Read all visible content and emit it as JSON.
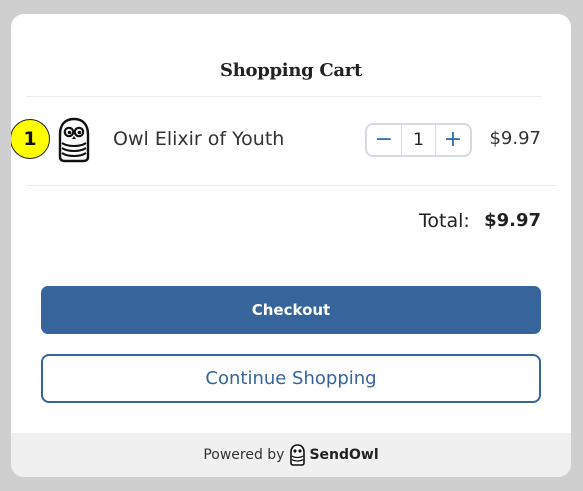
{
  "cart": {
    "title": "Shopping Cart",
    "item": {
      "badge": "1",
      "name": "Owl Elixir of Youth",
      "quantity": "1",
      "decrement_symbol": "−",
      "increment_symbol": "+",
      "price": "$9.97",
      "icon": "owl-logo-icon"
    },
    "total_label": "Total:",
    "total_value": "$9.97",
    "checkout_label": "Checkout",
    "continue_label": "Continue Shopping"
  },
  "footer": {
    "powered_by": "Powered by",
    "brand": "SendOwl",
    "brand_icon": "sendowl-logo-icon"
  },
  "colors": {
    "page_bg": "#cfcfcf",
    "accent": "#37649b",
    "badge": "#ffff00",
    "footer_bg": "#f0f0f0"
  }
}
